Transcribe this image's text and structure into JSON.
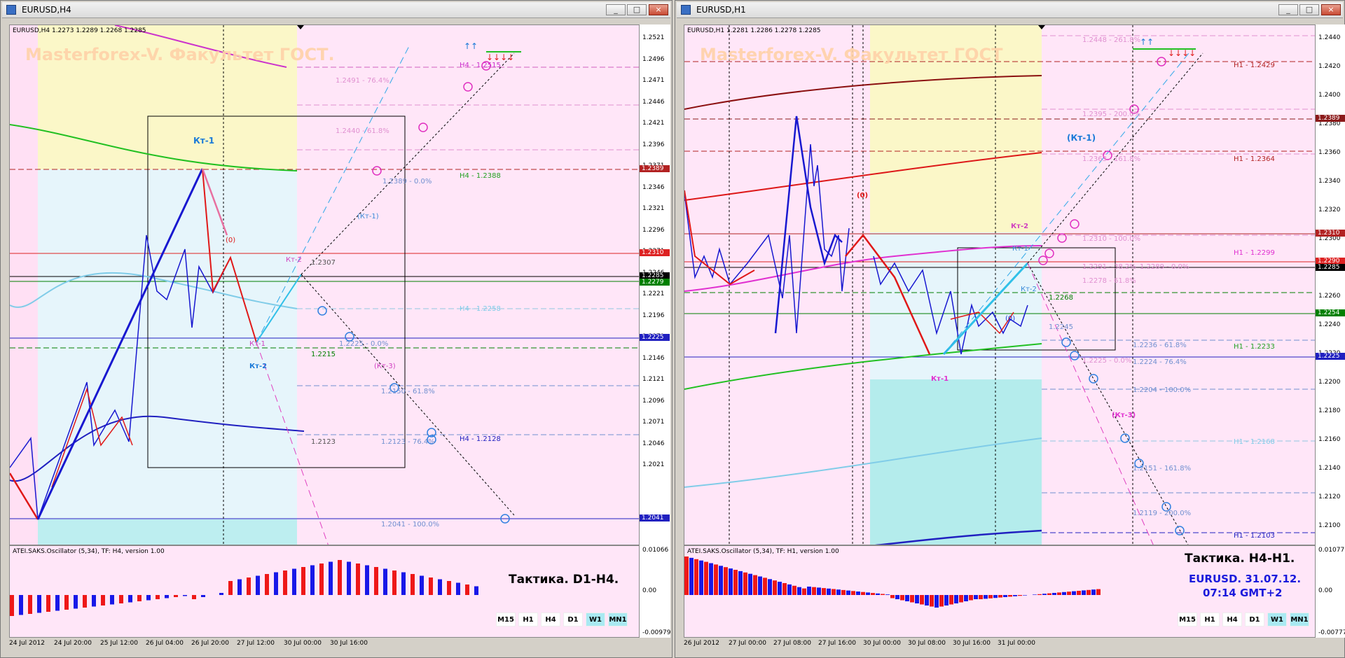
{
  "left": {
    "window_title": "EURUSD,H4",
    "header": "EURUSD,H4  1.2273 1.2289 1.2268 1.2285",
    "watermark": "Masterforex-V. Факультет ГОСТ.",
    "price_labels": [
      "1.2521",
      "1.2496",
      "1.2471",
      "1.2446",
      "1.2421",
      "1.2396",
      "1.2371",
      "1.2346",
      "1.2321",
      "1.2296",
      "1.2271",
      "1.2246",
      "1.2221",
      "1.2196",
      "1.2171",
      "1.2146",
      "1.2121",
      "1.2096",
      "1.2071",
      "1.2046",
      "1.2021"
    ],
    "price_boxes": [
      {
        "text": "1.2389",
        "color": "#b22222"
      },
      {
        "text": "1.2310",
        "color": "#dd2222"
      },
      {
        "text": "1.2285",
        "color": "#000000"
      },
      {
        "text": "1.2279",
        "color": "#008000"
      },
      {
        "text": "1.2225",
        "color": "#2020c0"
      },
      {
        "text": "1.2041",
        "color": "#2020c0"
      }
    ],
    "time_labels": [
      "24 Jul 2012",
      "24 Jul 20:00",
      "25 Jul 12:00",
      "26 Jul 04:00",
      "26 Jul 20:00",
      "27 Jul 12:00",
      "30 Jul 00:00",
      "30 Jul 16:00"
    ],
    "chart_labels": {
      "kt1": "Кт-1",
      "kt1_paren": "(Кт-1)",
      "kt2": "Кт-2",
      "kt2_b": "Кт-2",
      "kt3": "(Кт-3)",
      "zero": "(0)",
      "kt1_small": "Кт-1",
      "l1": "1.2491 - 76.4%",
      "l2": "1.2440 - 61.8%",
      "l3": "1.2389 - 0.0%",
      "l4": "1.2307",
      "l5": "1.2215",
      "l6": "1.2225 - 0.0%",
      "l7": "1.2150 - 61.8%",
      "l8": "1.2123",
      "l9": "1.2123 - 76.4%",
      "l10": "1.2041 - 100.0%",
      "h4a": "H4 - 1.2515",
      "h4b": "H4 - 1.2388",
      "h4c": "H4 - 1.2258",
      "h4d": "H4 - 1.2128"
    },
    "osc_header": "ATEI.SAKS.Oscillator (5,34), TF: H4, version 1.00",
    "osc_labels": [
      "0.01066",
      "0.00",
      "-0.00979"
    ],
    "tactic": "Тактика. D1-H4.",
    "tfs": [
      "M15",
      "H1",
      "H4",
      "D1",
      "W1",
      "MN1"
    ],
    "active_tfs": [
      "W1",
      "MN1"
    ],
    "buttons": {
      "min": "_",
      "max": "□",
      "close": "×"
    }
  },
  "right": {
    "window_title": "EURUSD,H1",
    "header": "EURUSD,H1  1.2281 1.2286 1.2278 1.2285",
    "watermark": "Masterforex-V. Факультет ГОСТ",
    "price_labels": [
      "1.2440",
      "1.2420",
      "1.2400",
      "1.2380",
      "1.2360",
      "1.2340",
      "1.2320",
      "1.2300",
      "1.2280",
      "1.2260",
      "1.2240",
      "1.2220",
      "1.2200",
      "1.2180",
      "1.2160",
      "1.2140",
      "1.2120",
      "1.2100"
    ],
    "price_boxes": [
      {
        "text": "1.2389",
        "color": "#8b1a1a"
      },
      {
        "text": "1.2310",
        "color": "#b22222"
      },
      {
        "text": "1.2290",
        "color": "#dd2222"
      },
      {
        "text": "1.2285",
        "color": "#000000"
      },
      {
        "text": "1.2254",
        "color": "#008000"
      },
      {
        "text": "1.2225",
        "color": "#2020c0"
      }
    ],
    "time_labels": [
      "26 Jul 2012",
      "27 Jul 00:00",
      "27 Jul 08:00",
      "27 Jul 16:00",
      "30 Jul 00:00",
      "30 Jul 08:00",
      "30 Jul 16:00",
      "31 Jul 00:00"
    ],
    "chart_labels": {
      "kt1p": "(Кт-1)",
      "kt2": "Кт-2",
      "kt1b": "Кт-1",
      "kt2b": "Кт-2",
      "zero_a": "(0)",
      "zero_b": "(0)",
      "kt1c": "Кт-1",
      "kt3": "(Кт-3)",
      "f1": "1.2448 - 261.8%",
      "f2": "1.2395 - 200.0%",
      "f3": "1.2363 - 161.8%",
      "f4": "1.2310 - 100.0%",
      "f5": "1.2291 - 38.2%",
      "f6": "1.2289 - 0.0%",
      "f7": "1.2278 - 61.8%",
      "f8": "1.2268",
      "f9": "1.2245",
      "f10": "1.2236 - 61.8%",
      "f11": "1.2225 - 0.0%",
      "f12": "1.2224 - 76.4%",
      "f13": "1.2204 - 100.0%",
      "f14": "1.2151 - 161.8%",
      "f15": "1.2119 - 200.0%",
      "h1a": "H1 - 1.2429",
      "h1b": "H1 - 1.2364",
      "h1c": "H1 - 1.2299",
      "h1d": "H1 - 1.2233",
      "h1e": "H1 - 1.2168",
      "h1f": "H1 - 1.2103"
    },
    "osc_header": "ATEI.SAKS.Oscillator (5,34), TF: H1, version 1.00",
    "osc_labels": [
      "0.01077",
      "0.00",
      "-0.00777"
    ],
    "tactic": "Тактика. H4-H1.",
    "info1": "EURUSD. 31.07.12.",
    "info2": "07:14  GMT+2",
    "tfs": [
      "M15",
      "H1",
      "H4",
      "D1",
      "W1",
      "MN1"
    ],
    "active_tfs": [
      "W1",
      "MN1"
    ],
    "buttons": {
      "min": "_",
      "max": "□",
      "close": "×"
    }
  }
}
